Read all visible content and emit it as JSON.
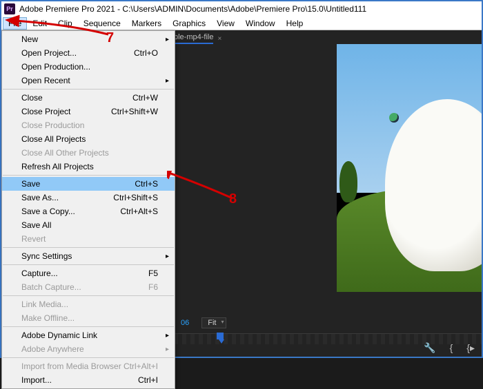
{
  "title": "Adobe Premiere Pro 2021 - C:\\Users\\ADMIN\\Documents\\Adobe\\Premiere Pro\\15.0\\Untitled111",
  "logo": "Pr",
  "menubar": [
    "File",
    "Edit",
    "Clip",
    "Sequence",
    "Markers",
    "Graphics",
    "View",
    "Window",
    "Help"
  ],
  "tab": {
    "name": "ple-mp4-file",
    "close": "×"
  },
  "fitbar": {
    "timecode": "06",
    "fit_label": "Fit"
  },
  "icons": {
    "wrench": "🔧",
    "in": "{",
    "out": "}",
    "oplus": "{▸"
  },
  "annotations": {
    "seven": "7",
    "eight": "8"
  },
  "menu": [
    {
      "t": "item",
      "label": "New",
      "submenu": true
    },
    {
      "t": "item",
      "label": "Open Project...",
      "shortcut": "Ctrl+O"
    },
    {
      "t": "item",
      "label": "Open Production..."
    },
    {
      "t": "item",
      "label": "Open Recent",
      "submenu": true
    },
    {
      "t": "sep"
    },
    {
      "t": "item",
      "label": "Close",
      "shortcut": "Ctrl+W"
    },
    {
      "t": "item",
      "label": "Close Project",
      "shortcut": "Ctrl+Shift+W"
    },
    {
      "t": "item",
      "label": "Close Production",
      "disabled": true
    },
    {
      "t": "item",
      "label": "Close All Projects"
    },
    {
      "t": "item",
      "label": "Close All Other Projects",
      "disabled": true
    },
    {
      "t": "item",
      "label": "Refresh All Projects"
    },
    {
      "t": "sep"
    },
    {
      "t": "item",
      "label": "Save",
      "shortcut": "Ctrl+S",
      "highlight": true
    },
    {
      "t": "item",
      "label": "Save As...",
      "shortcut": "Ctrl+Shift+S"
    },
    {
      "t": "item",
      "label": "Save a Copy...",
      "shortcut": "Ctrl+Alt+S"
    },
    {
      "t": "item",
      "label": "Save All"
    },
    {
      "t": "item",
      "label": "Revert",
      "disabled": true
    },
    {
      "t": "sep"
    },
    {
      "t": "item",
      "label": "Sync Settings",
      "submenu": true
    },
    {
      "t": "sep"
    },
    {
      "t": "item",
      "label": "Capture...",
      "shortcut": "F5"
    },
    {
      "t": "item",
      "label": "Batch Capture...",
      "shortcut": "F6",
      "disabled": true
    },
    {
      "t": "sep"
    },
    {
      "t": "item",
      "label": "Link Media...",
      "disabled": true
    },
    {
      "t": "item",
      "label": "Make Offline...",
      "disabled": true
    },
    {
      "t": "sep"
    },
    {
      "t": "item",
      "label": "Adobe Dynamic Link",
      "submenu": true
    },
    {
      "t": "item",
      "label": "Adobe Anywhere",
      "submenu": true,
      "disabled": true
    },
    {
      "t": "sep"
    },
    {
      "t": "item",
      "label": "Import from Media Browser",
      "shortcut": "Ctrl+Alt+I",
      "disabled": true
    },
    {
      "t": "item",
      "label": "Import...",
      "shortcut": "Ctrl+I"
    }
  ]
}
